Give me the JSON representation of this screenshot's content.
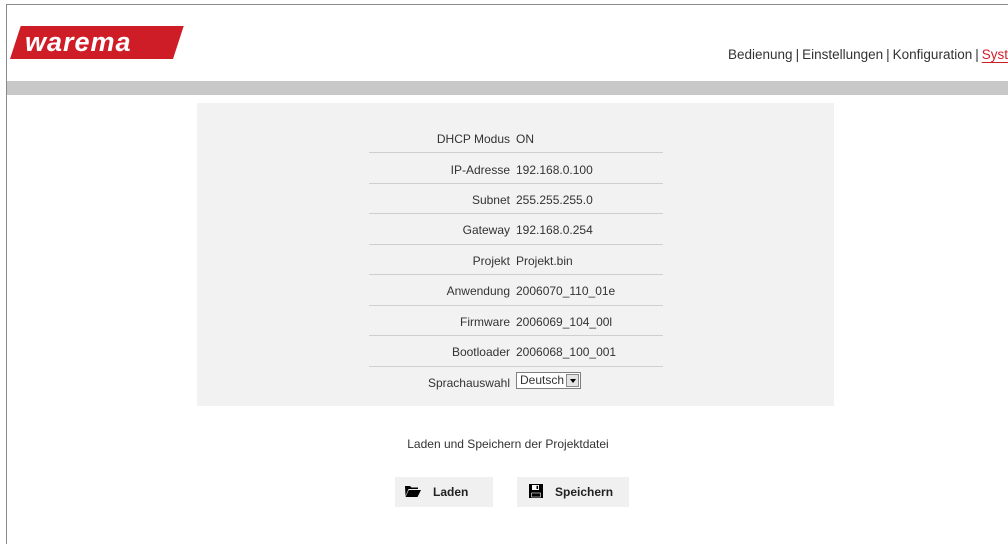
{
  "brand": {
    "logo_text": "warema",
    "color": "#cf1d28"
  },
  "nav": {
    "items": [
      {
        "label": "Bedienung"
      },
      {
        "label": "Einstellungen"
      },
      {
        "label": "Konfiguration"
      },
      {
        "label": "Syst",
        "active": true
      }
    ],
    "separator": "|"
  },
  "info": {
    "rows": [
      {
        "label": "DHCP Modus",
        "value": "ON"
      },
      {
        "label": "IP-Adresse",
        "value": "192.168.0.100"
      },
      {
        "label": "Subnet",
        "value": "255.255.255.0"
      },
      {
        "label": "Gateway",
        "value": "192.168.0.254"
      },
      {
        "label": "Projekt",
        "value": "Projekt.bin"
      },
      {
        "label": "Anwendung",
        "value": "2006070_110_01e"
      },
      {
        "label": "Firmware",
        "value": "2006069_104_00l"
      },
      {
        "label": "Bootloader",
        "value": "2006068_100_001"
      }
    ],
    "language": {
      "label": "Sprachauswahl",
      "selected": "Deutsch"
    }
  },
  "project_file": {
    "caption": "Laden und Speichern der Projektdatei",
    "load_label": "Laden",
    "save_label": "Speichern"
  }
}
